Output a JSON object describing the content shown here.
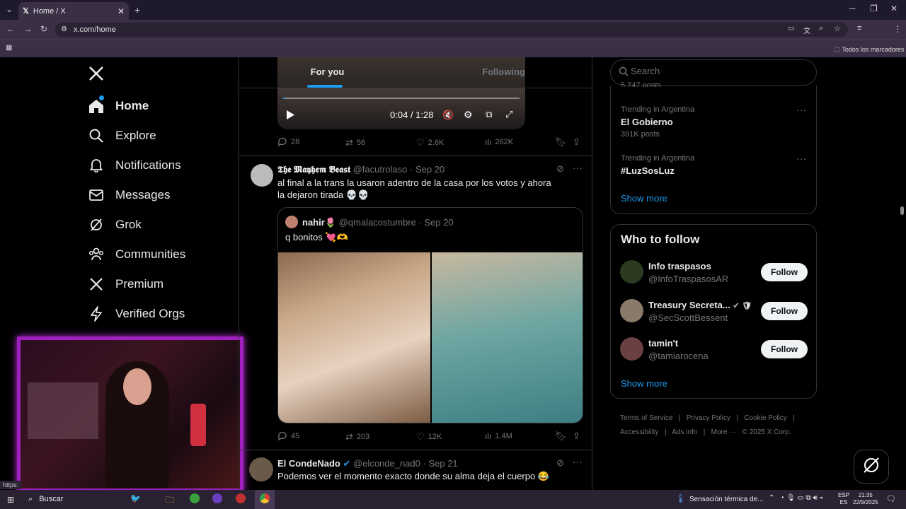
{
  "browser": {
    "tab_title": "Home / X",
    "url": "x.com/home",
    "bookmarks_label": "Todos los marcadores"
  },
  "nav": {
    "items": [
      {
        "label": "Home",
        "icon": "home-icon"
      },
      {
        "label": "Explore",
        "icon": "search-icon"
      },
      {
        "label": "Notifications",
        "icon": "bell-icon"
      },
      {
        "label": "Messages",
        "icon": "envelope-icon"
      },
      {
        "label": "Grok",
        "icon": "grok-icon"
      },
      {
        "label": "Communities",
        "icon": "people-icon"
      },
      {
        "label": "Premium",
        "icon": "x-logo-icon"
      },
      {
        "label": "Verified Orgs",
        "icon": "lightning-icon"
      }
    ]
  },
  "feed": {
    "tabs": {
      "for_you": "For you",
      "following": "Following"
    },
    "video": {
      "time": "0:04 / 1:28"
    },
    "post1_stats": {
      "replies": "28",
      "reposts": "56",
      "likes": "2.6K",
      "views": "262K"
    },
    "post2": {
      "author": "𝕿𝖍𝖊 𝕸𝖆𝖞𝖍𝖊𝖒 𝕭𝖊𝖆𝖘𝖙",
      "handle": "@facutrolaso",
      "date": "· Sep 20",
      "text": "al final a la trans la usaron adentro de la casa por los votos y ahora la dejaron tirada 💀💀",
      "quote": {
        "author": "nahir🌷",
        "handle": "@qmalacostumbre",
        "date": "· Sep 20",
        "text": "q bonitos 💘🫶"
      },
      "stats": {
        "replies": "45",
        "reposts": "203",
        "likes": "12K",
        "views": "1.4M"
      }
    },
    "post3": {
      "author": "El CondeNado",
      "handle": "@elconde_nad0",
      "date": "· Sep 21",
      "text": "Podemos ver el momento exacto donde su alma deja el cuerpo 😂"
    }
  },
  "right": {
    "search_placeholder": "Search",
    "partial_count": "5,747 posts",
    "trends": [
      {
        "context": "Trending in Argentina",
        "name": "El Gobierno",
        "posts": "391K posts"
      },
      {
        "context": "Trending in Argentina",
        "name": "#LuzSosLuz",
        "posts": ""
      }
    ],
    "show_more": "Show more",
    "who_to_follow": {
      "title": "Who to follow",
      "users": [
        {
          "name": "Info traspasos",
          "handle": "@InfoTraspasosAR",
          "button": "Follow"
        },
        {
          "name": "Treasury Secreta...",
          "handle": "@SecScottBessent",
          "button": "Follow"
        },
        {
          "name": "tamin't",
          "handle": "@tamiarocena",
          "button": "Follow"
        }
      ],
      "show_more": "Show more"
    },
    "footer": {
      "links": [
        "Terms of Service",
        "|",
        "Privacy Policy",
        "|",
        "Cookie Policy",
        "|"
      ],
      "links2": [
        "Accessibility",
        "|",
        "Ads info",
        "|",
        "More ···",
        "© 2025 X Corp."
      ]
    }
  },
  "taskbar": {
    "search": "Buscar",
    "weather": "Sensación térmica de...",
    "lang": "ESP",
    "lang2": "ES",
    "time": "21:35",
    "date": "22/9/2025",
    "status_url": "https:"
  },
  "colors": {
    "accent": "#1d9bf0",
    "bg": "#000000",
    "border": "#2f3336",
    "webcam_frame": "#a020c0"
  }
}
